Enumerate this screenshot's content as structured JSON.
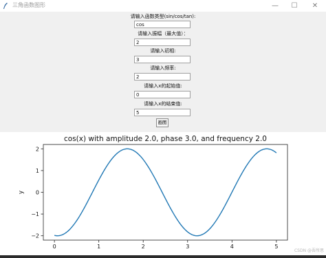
{
  "window": {
    "title": "三角函数图形",
    "minimize_glyph": "—",
    "maximize_glyph": "☐",
    "close_glyph": "✕"
  },
  "form": {
    "fields": [
      {
        "label": "请输入函数类型(sin/cos/tan):",
        "value": "cos"
      },
      {
        "label": "请输入振幅（最大值）：",
        "value": "2"
      },
      {
        "label": "请输入初相:",
        "value": "3"
      },
      {
        "label": "请输入频率:",
        "value": "2"
      },
      {
        "label": "请输入x的起始值:",
        "value": "0"
      },
      {
        "label": "请输入x的结束值:",
        "value": "5"
      }
    ],
    "draw_button_label": "画图"
  },
  "chart_data": {
    "type": "line",
    "title": "cos(x) with amplitude 2.0, phase 3.0, and frequency 2.0",
    "xlabel": "",
    "ylabel": "y",
    "xlim": [
      -0.25,
      5.25
    ],
    "ylim": [
      -2.2,
      2.2
    ],
    "x_ticks": [
      "0",
      "1",
      "2",
      "3",
      "4",
      "5"
    ],
    "y_ticks": [
      "−2",
      "−1",
      "0",
      "1",
      "2"
    ],
    "series": [
      {
        "color": "#1f77b4",
        "amplitude": 2.0,
        "phase": 3.0,
        "frequency": 2.0,
        "x_start": 0,
        "x_end": 5
      }
    ],
    "grid": false
  },
  "watermark": "CSDN @吾所思"
}
